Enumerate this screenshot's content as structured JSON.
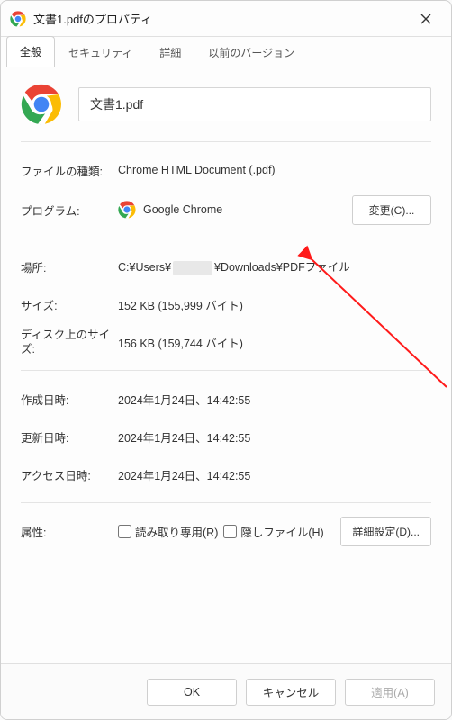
{
  "window": {
    "title": "文書1.pdfのプロパティ"
  },
  "tabs": {
    "general": "全般",
    "security": "セキュリティ",
    "details": "詳細",
    "previous": "以前のバージョン"
  },
  "header": {
    "filename": "文書1.pdf"
  },
  "labels": {
    "filetype": "ファイルの種類:",
    "program": "プログラム:",
    "location": "場所:",
    "size": "サイズ:",
    "disksize": "ディスク上のサイズ:",
    "created": "作成日時:",
    "modified": "更新日時:",
    "accessed": "アクセス日時:",
    "attributes": "属性:"
  },
  "values": {
    "filetype": "Chrome HTML Document (.pdf)",
    "program": "Google Chrome",
    "location_prefix": "C:¥Users¥",
    "location_suffix": "¥Downloads¥PDFファイル",
    "size": "152 KB (155,999 バイト)",
    "disksize": "156 KB (159,744 バイト)",
    "created": "2024年1月24日、14:42:55",
    "modified": "2024年1月24日、14:42:55",
    "accessed": "2024年1月24日、14:42:55"
  },
  "buttons": {
    "change": "変更(C)...",
    "advanced": "詳細設定(D)...",
    "ok": "OK",
    "cancel": "キャンセル",
    "apply": "適用(A)"
  },
  "checkboxes": {
    "readonly": "読み取り専用(R)",
    "hidden": "隠しファイル(H)"
  }
}
